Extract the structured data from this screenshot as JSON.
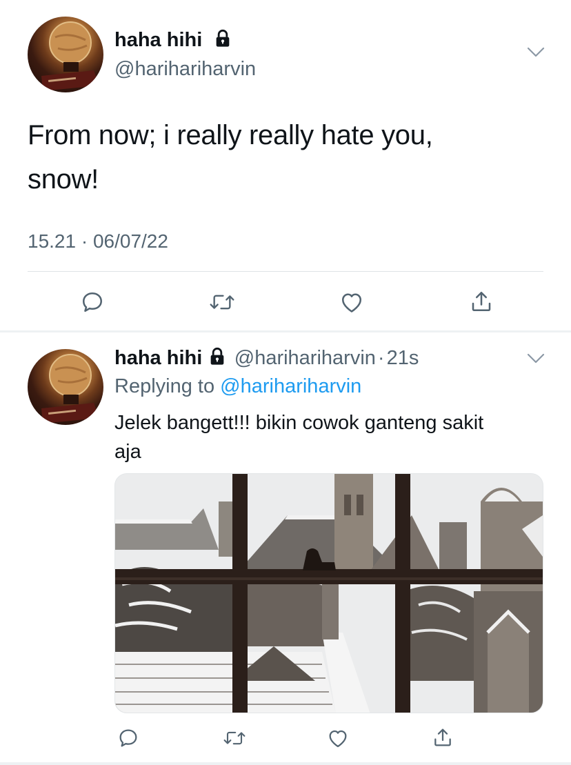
{
  "main_tweet": {
    "display_name": "haha hihi",
    "handle": "@harihariharvin",
    "text_line1": "From now; i really really hate you,",
    "text_line2": "snow!",
    "timestamp": "15.21 · 06/07/22",
    "actions": [
      "reply-icon",
      "retweet-icon",
      "like-icon",
      "share-icon"
    ]
  },
  "reply_tweet": {
    "display_name": "haha hihi",
    "handle": "@harihariharvin",
    "dot": "·",
    "age": "21s",
    "replying_prefix": "Replying to",
    "replying_to": "@harihariharvin",
    "text_line1": "Jelek bangett!!! bikin cowok ganteng sakit",
    "text_line2": "aja",
    "actions": [
      "reply-icon",
      "retweet-icon",
      "like-icon",
      "share-icon"
    ]
  },
  "colors": {
    "text": "#0f1419",
    "muted": "#536471",
    "link": "#1d9bf0",
    "divider": "#dfe3e6"
  }
}
